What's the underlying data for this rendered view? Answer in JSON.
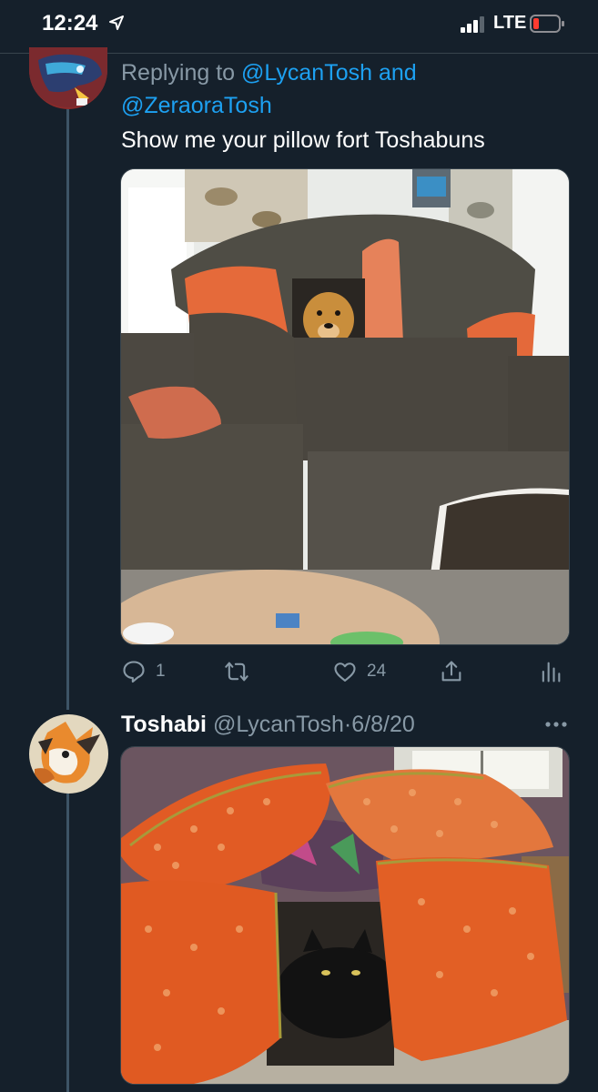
{
  "status_bar": {
    "time": "12:24",
    "network": "LTE",
    "icons": [
      "location-arrow-icon",
      "signal-icon",
      "battery-icon"
    ],
    "battery_color": "#ff3b30"
  },
  "tweet1": {
    "reply_prefix": "Replying to",
    "mention1": "@LycanTosh",
    "conjunction": "and",
    "mention2": "@ZeraoraTosh",
    "text": "Show me your pillow fort Toshabuns",
    "actions": {
      "reply_count": "1",
      "retweet_count": "",
      "like_count": "24"
    }
  },
  "tweet2": {
    "display_name": "Toshabi",
    "handle": "@LycanTosh",
    "separator": "·",
    "date": "6/8/20"
  },
  "colors": {
    "background": "#15202b",
    "accent": "#1da1f2",
    "secondary_text": "#8899a6",
    "thread_line": "#3d5466"
  }
}
